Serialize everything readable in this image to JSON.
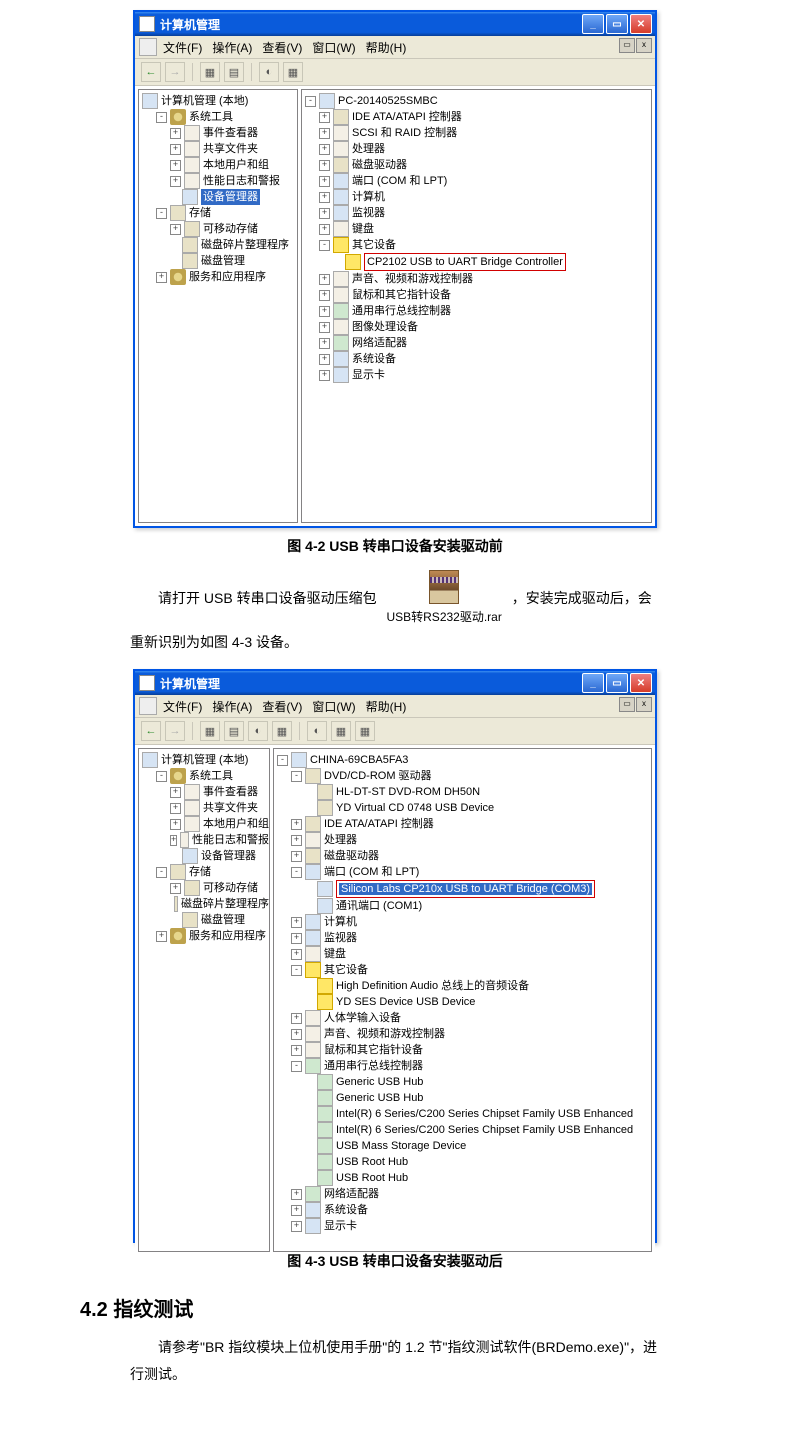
{
  "window1": {
    "title": "计算机管理",
    "menus": [
      "文件(F)",
      "操作(A)",
      "查看(V)",
      "窗口(W)",
      "帮助(H)"
    ],
    "left_tree": {
      "root": "计算机管理 (本地)",
      "items": [
        {
          "label": "系统工具",
          "children": [
            {
              "label": "事件查看器"
            },
            {
              "label": "共享文件夹"
            },
            {
              "label": "本地用户和组"
            },
            {
              "label": "性能日志和警报"
            },
            {
              "label": "设备管理器",
              "selected": true
            }
          ]
        },
        {
          "label": "存储",
          "children": [
            {
              "label": "可移动存储"
            },
            {
              "label": "磁盘碎片整理程序"
            },
            {
              "label": "磁盘管理"
            }
          ]
        },
        {
          "label": "服务和应用程序"
        }
      ]
    },
    "right_tree": {
      "root": "PC-20140525SMBC",
      "items": [
        "IDE ATA/ATAPI 控制器",
        "SCSI 和 RAID 控制器",
        "处理器",
        "磁盘驱动器",
        "端口 (COM 和 LPT)",
        "计算机",
        "监视器",
        "键盘",
        "其它设备",
        "声音、视频和游戏控制器",
        "鼠标和其它指针设备",
        "通用串行总线控制器",
        "图像处理设备",
        "网络适配器",
        "系统设备",
        "显示卡"
      ],
      "highlighted_other_device": "CP2102 USB to UART Bridge Controller"
    }
  },
  "caption1": "图  4-2 USB 转串口设备安装驱动前",
  "paragraph": {
    "line1a": "请打开 USB 转串口设备驱动压缩包",
    "rar_label": "USB转RS232驱动.rar",
    "line1b": "，安装完成驱动后，会",
    "line2": "重新识别为如图 4-3 设备。"
  },
  "window2": {
    "title": "计算机管理",
    "menus": [
      "文件(F)",
      "操作(A)",
      "查看(V)",
      "窗口(W)",
      "帮助(H)"
    ],
    "left_tree": {
      "root": "计算机管理 (本地)",
      "items": [
        {
          "label": "系统工具",
          "children": [
            {
              "label": "事件查看器"
            },
            {
              "label": "共享文件夹"
            },
            {
              "label": "本地用户和组"
            },
            {
              "label": "性能日志和警报"
            },
            {
              "label": "设备管理器",
              "selected": true
            }
          ]
        },
        {
          "label": "存储",
          "children": [
            {
              "label": "可移动存储"
            },
            {
              "label": "磁盘碎片整理程序"
            },
            {
              "label": "磁盘管理"
            }
          ]
        },
        {
          "label": "服务和应用程序"
        }
      ]
    },
    "right_tree": {
      "root": "CHINA-69CBA5FA3",
      "dvd": {
        "label": "DVD/CD-ROM 驱动器",
        "children": [
          "HL-DT-ST DVD-ROM DH50N",
          "YD Virtual CD 0748 USB Device"
        ]
      },
      "ide": "IDE ATA/ATAPI 控制器",
      "cpu": "处理器",
      "disk": "磁盘驱动器",
      "ports": {
        "label": "端口 (COM 和 LPT)",
        "children": [
          "Silicon Labs CP210x USB to UART Bridge (COM3)",
          "通讯端口 (COM1)"
        ]
      },
      "computer": "计算机",
      "monitor": "监视器",
      "keyboard": "键盘",
      "other": {
        "label": "其它设备",
        "children": [
          "High Definition Audio 总线上的音频设备",
          "YD SES Device USB Device"
        ]
      },
      "hid": "人体学输入设备",
      "avg": "声音、视频和游戏控制器",
      "mouse": "鼠标和其它指针设备",
      "usb": {
        "label": "通用串行总线控制器",
        "children": [
          "Generic USB Hub",
          "Generic USB Hub",
          "Intel(R) 6 Series/C200 Series Chipset Family USB Enhanced",
          "Intel(R) 6 Series/C200 Series Chipset Family USB Enhanced",
          "USB Mass Storage Device",
          "USB Root Hub",
          "USB Root Hub"
        ]
      },
      "net": "网络适配器",
      "sys": "系统设备",
      "display": "显示卡"
    }
  },
  "caption2": "图  4-3 USB 转串口设备安装驱动后",
  "section_heading": "4.2   指纹测试",
  "paragraph2": "请参考\"BR 指纹模块上位机使用手册\"的 1.2 节\"指纹测试软件(BRDemo.exe)\"，进行测试。"
}
